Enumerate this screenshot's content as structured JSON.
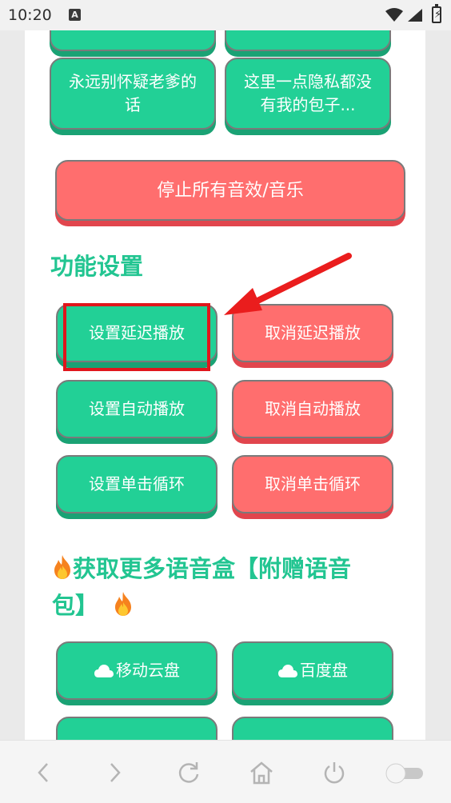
{
  "status_bar": {
    "time": "10:20",
    "notification_icon": "A"
  },
  "top_buttons": [
    {
      "label": "",
      "color": "green"
    },
    {
      "label": "",
      "color": "green"
    },
    {
      "label_line1": "永远别怀疑老爹的",
      "label_line2": "话",
      "color": "green"
    },
    {
      "label_line1": "这里一点隐私都没",
      "label_line2": "有我的包子...",
      "color": "green"
    }
  ],
  "stop_button": {
    "label": "停止所有音效/音乐"
  },
  "settings": {
    "title": "功能设置",
    "buttons": [
      {
        "set": "设置延迟播放",
        "cancel": "取消延迟播放"
      },
      {
        "set": "设置自动播放",
        "cancel": "取消自动播放"
      },
      {
        "set": "设置单击循环",
        "cancel": "取消单击循环"
      }
    ]
  },
  "more": {
    "title_line1": "获取更多语音盒【附赠语音",
    "title_line2": "包】",
    "links": [
      {
        "label": "移动云盘"
      },
      {
        "label": "百度盘"
      }
    ]
  },
  "colors": {
    "green": "#22d096",
    "red": "#ff6e6e",
    "title_green": "#22c591",
    "highlight": "#e0161c"
  },
  "nav": [
    "back-icon",
    "forward-icon",
    "refresh-icon",
    "home-icon",
    "power-icon",
    "toggle-switch"
  ]
}
